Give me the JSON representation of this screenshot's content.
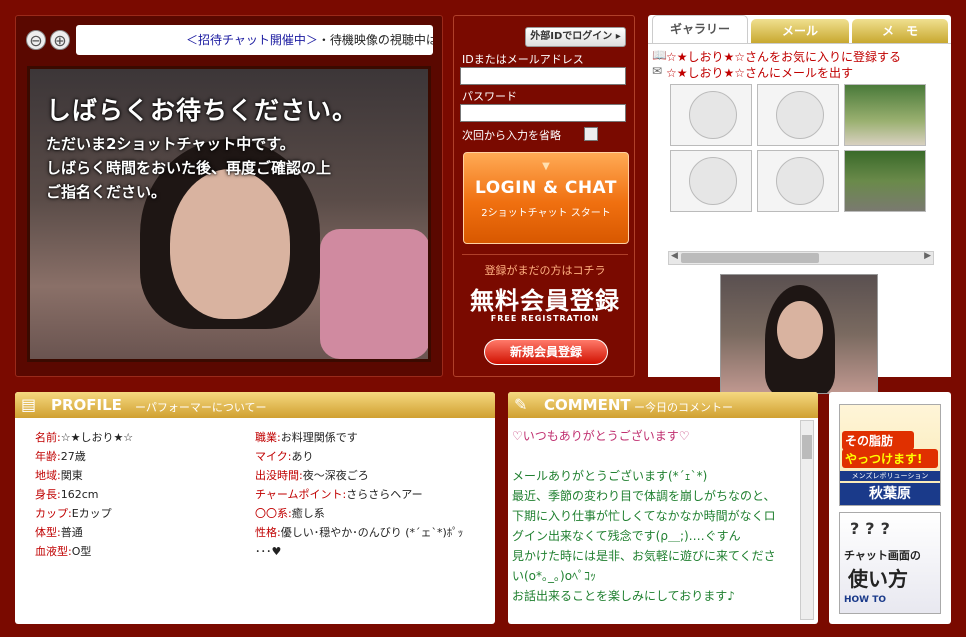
{
  "video": {
    "zoom_out": "⊖",
    "zoom_in": "⊕",
    "ticker_link": "＜招待チャット開催中＞",
    "ticker_text": "・待機映像の視聴中は、",
    "wait_title": "しばらくお待ちください。",
    "wait_line1": "ただいま2ショットチャット中です。",
    "wait_line2": "しばらく時間をおいた後、再度ご確認の上",
    "wait_line3": "ご指名ください。"
  },
  "login": {
    "external_login": "外部IDでログイン",
    "id_label": "IDまたはメールアドレス",
    "password_label": "パスワード",
    "remember_label": "次回から入力を省略",
    "login_main": "LOGIN & CHAT",
    "login_sub": "2ショットチャット スタート",
    "register_note": "登録がまだの方はコチラ",
    "register_big": "無料会員登録",
    "register_en": "FREE REGISTRATION",
    "new_register": "新規会員登録"
  },
  "gallery": {
    "tabs": [
      {
        "label": "ギャラリー"
      },
      {
        "label": "メール"
      },
      {
        "label": "メ　モ"
      }
    ],
    "favorite_text": "☆★しおり★☆さんをお気に入りに登録する",
    "mail_text": "☆★しおり★☆さんにメールを出す"
  },
  "profile": {
    "title": "PROFILE",
    "subtitle": "ーパフォーマーについてー",
    "left": [
      {
        "key": "名前:",
        "value": "☆★しおり★☆"
      },
      {
        "key": "年齢:",
        "value": "27歳"
      },
      {
        "key": "地域:",
        "value": "関東"
      },
      {
        "key": "身長:",
        "value": "162cm"
      },
      {
        "key": "カップ:",
        "value": "Eカップ"
      },
      {
        "key": "体型:",
        "value": "普通"
      },
      {
        "key": "血液型:",
        "value": "O型"
      }
    ],
    "right": [
      {
        "key": "職業:",
        "value": "お料理関係です"
      },
      {
        "key": "マイク:",
        "value": "あり"
      },
      {
        "key": "出没時間:",
        "value": "夜〜深夜ごろ"
      },
      {
        "key": "チャームポイント:",
        "value": "さらさらヘアー"
      },
      {
        "key": "〇〇系:",
        "value": "癒し系"
      },
      {
        "key": "性格:",
        "value": "優しい･穏やか･のんびり (*´ェ`*)ﾎﾟｯ"
      },
      {
        "key": "",
        "value": "･･･♥"
      }
    ]
  },
  "comment": {
    "title": "COMMENT",
    "subtitle": "ー今日のコメントー",
    "lines": [
      "♡いつもありがとうございます♡",
      "",
      "メールありがとうございます(*´ｪ`*)",
      "最近、季節の変わり目で体調を崩しがちなのと、",
      "下期に入り仕事が忙しくてなかなか時間がなくロ",
      "グイン出来なくて残念です(ρ＿;)‥‥ぐすん",
      "見かけた時には是非、お気軽に遊びに来てくださ",
      "い(o*｡_｡)oﾍﾟｺｯ",
      "お話出来ることを楽しみにしております♪"
    ]
  },
  "ads": {
    "ad1_line1": "その脂肪",
    "ad1_line2": "やっつけます!",
    "ad1_line3": "メンズレボリューション",
    "ad1_line4": "秋葉原",
    "ad2_line1": "チャット画面の",
    "ad2_line2": "使い方",
    "ad2_line3": "HOW TO"
  }
}
